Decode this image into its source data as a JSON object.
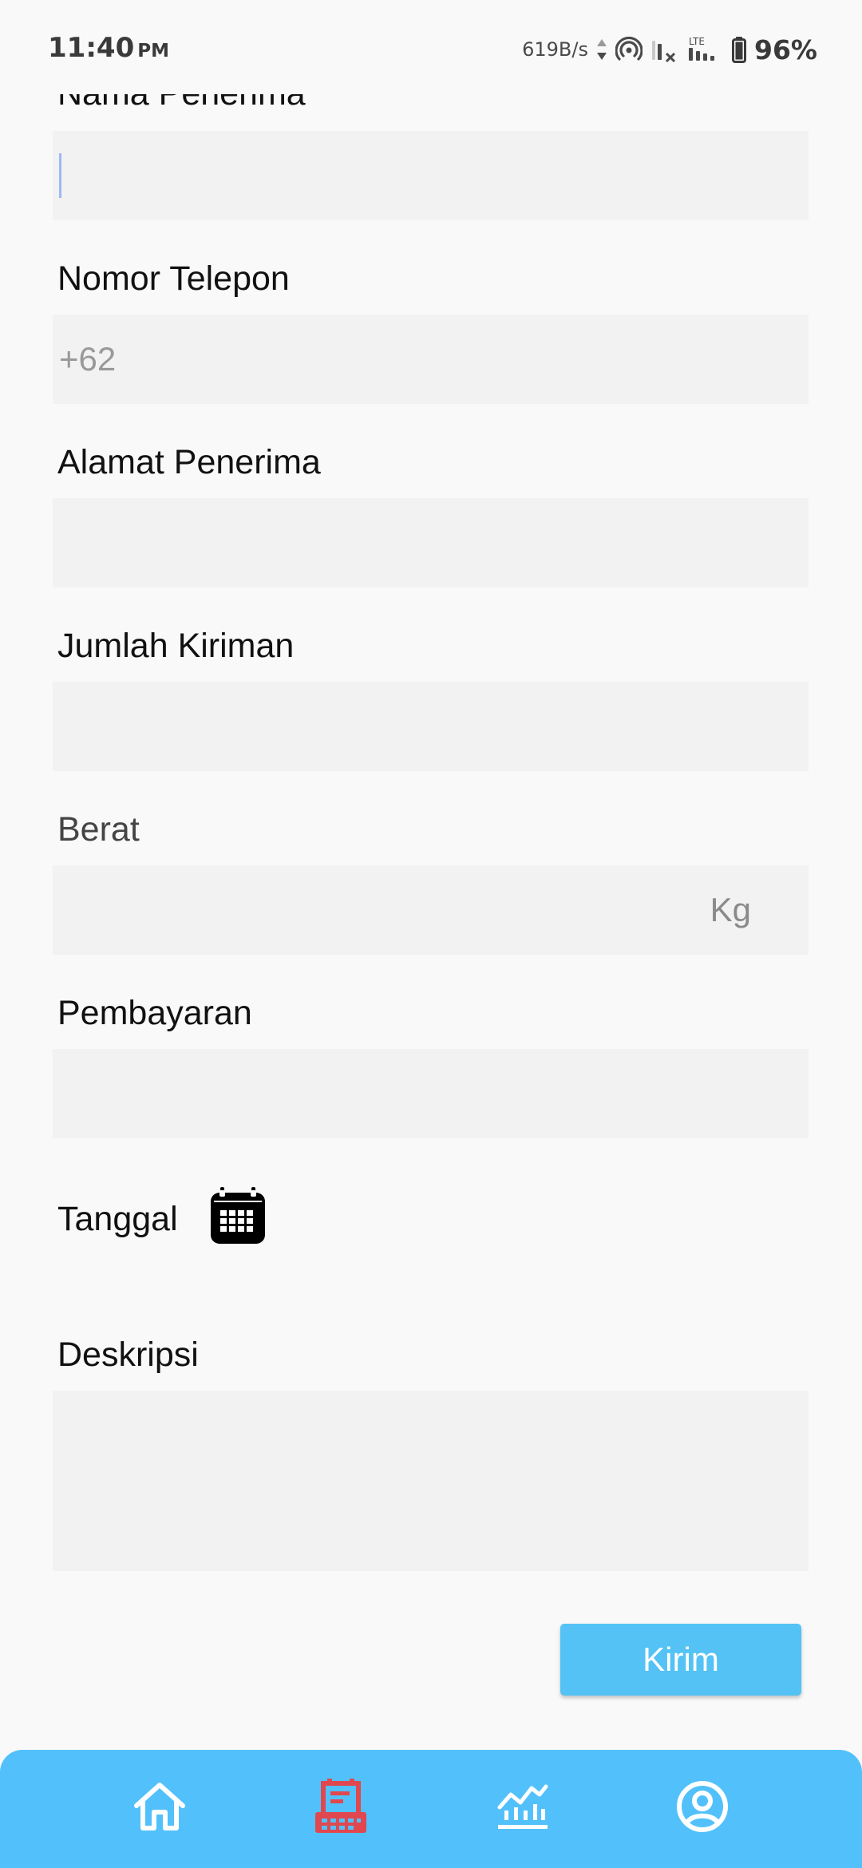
{
  "status_bar": {
    "time": "11:40",
    "ampm": "PM",
    "net_speed": "619B/s",
    "network_type": "LTE",
    "battery": "96%"
  },
  "form": {
    "recipient_name_label": "Nama Penerima",
    "phone_label": "Nomor Telepon",
    "phone_placeholder": "+62",
    "address_label": "Alamat Penerima",
    "quantity_label": "Jumlah Kiriman",
    "weight_label": "Berat",
    "weight_unit": "Kg",
    "payment_label": "Pembayaran",
    "date_label": "Tanggal",
    "description_label": "Deskripsi",
    "submit_label": "Kirim"
  },
  "bottom_nav": {
    "items": [
      {
        "icon": "home-icon",
        "active": false
      },
      {
        "icon": "cash-register-icon",
        "active": true
      },
      {
        "icon": "chart-icon",
        "active": false
      },
      {
        "icon": "profile-icon",
        "active": false
      }
    ],
    "active_color": "#e0474f",
    "inactive_color": "#ffffff"
  },
  "colors": {
    "accent": "#54c2f4",
    "nav_background": "#52c1fb",
    "input_background": "#f2f2f2",
    "caret": "#9db8f5"
  }
}
